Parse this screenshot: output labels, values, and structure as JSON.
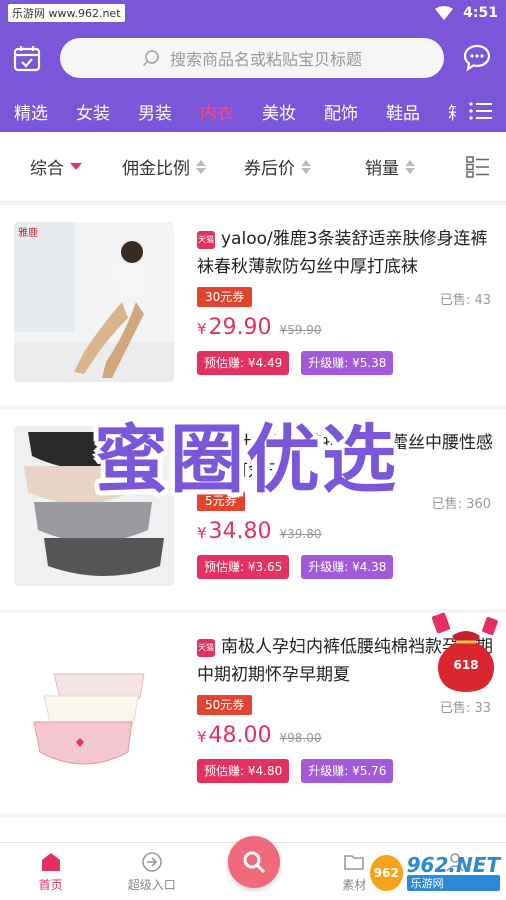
{
  "status_bar": {
    "watermark": "乐游网 www.962.net",
    "time": "4:51"
  },
  "header": {
    "search_placeholder": "搜索商品名或粘贴宝贝标题"
  },
  "categories": [
    "精选",
    "女装",
    "男装",
    "内衣",
    "美妆",
    "配饰",
    "鞋品",
    "箱"
  ],
  "active_category": "内衣",
  "sort": {
    "items": [
      "综合",
      "佣金比例",
      "券后价",
      "销量"
    ]
  },
  "products": [
    {
      "shop_tag": "天猫",
      "title": "yaloo/雅鹿3条装舒适亲肤修身连裤袜春秋薄款防勾丝中厚打底袜",
      "coupon": "30元券",
      "sold_label": "已售:",
      "sold": "43",
      "price_symbol": "¥",
      "price": "29.90",
      "orig": "¥59.90",
      "earn": "预估赚: ¥4.49",
      "upgrade": "升级赚: ¥5.38",
      "thumb_brand": "雅鹿"
    },
    {
      "shop_tag": "天猫",
      "title": "女士内裤纯棉抗菌无痕蕾丝中腰性感少女可爱三角...",
      "coupon": "5元券",
      "sold_label": "已售:",
      "sold": "360",
      "price_symbol": "¥",
      "price": "34.80",
      "orig": "¥39.80",
      "earn": "预估赚: ¥3.65",
      "upgrade": "升级赚: ¥4.38"
    },
    {
      "shop_tag": "天猫",
      "title": "南极人孕妇内裤低腰纯棉裆款孕晚期中期初期怀孕早期夏",
      "coupon": "50元券",
      "sold_label": "已售:",
      "sold": "33",
      "price_symbol": "¥",
      "price": "48.00",
      "orig": "¥98.00",
      "earn": "预估赚: ¥4.80",
      "upgrade": "升级赚: ¥5.76"
    }
  ],
  "overlay_title": "蜜圈优选",
  "floating_bag": "618",
  "bottom_tabs": [
    {
      "label": "首页",
      "icon": "home-icon"
    },
    {
      "label": "超级入口",
      "icon": "enter-icon"
    },
    {
      "label": "",
      "icon": "search-icon"
    },
    {
      "label": "素材",
      "icon": "folder-icon"
    },
    {
      "label": "我的",
      "icon": "user-icon"
    }
  ],
  "brand_watermark": {
    "circle": "962",
    "top": "962.NET",
    "bottom": "乐游网"
  },
  "colors": {
    "primary": "#7b56d8",
    "accent": "#e4315f",
    "upgrade": "#a35ad8",
    "coupon": "#e24430"
  }
}
